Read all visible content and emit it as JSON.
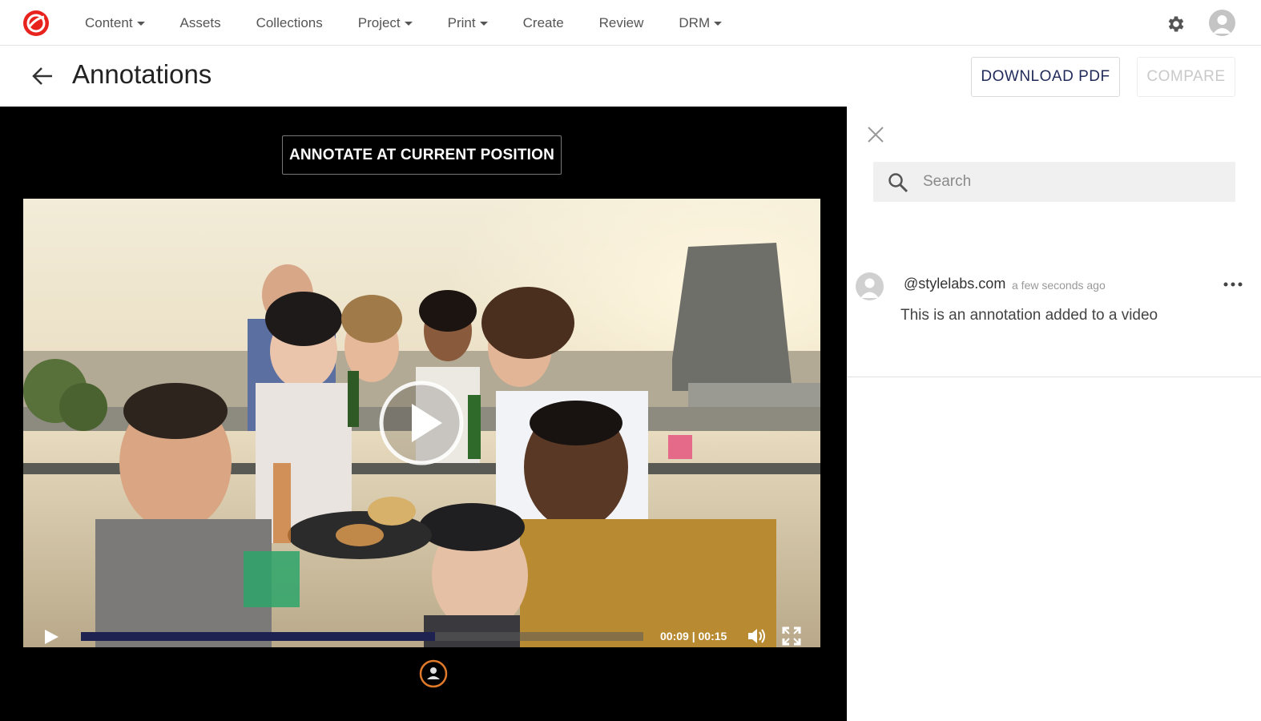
{
  "nav": {
    "items": [
      {
        "label": "Content",
        "dropdown": true
      },
      {
        "label": "Assets",
        "dropdown": false
      },
      {
        "label": "Collections",
        "dropdown": false
      },
      {
        "label": "Project",
        "dropdown": true
      },
      {
        "label": "Print",
        "dropdown": true
      },
      {
        "label": "Create",
        "dropdown": false
      },
      {
        "label": "Review",
        "dropdown": false
      },
      {
        "label": "DRM",
        "dropdown": true
      }
    ],
    "icons": {
      "logo": "brand-logo-icon",
      "settings": "gear-icon",
      "user": "user-avatar-icon"
    }
  },
  "header": {
    "title": "Annotations",
    "download_label": "DOWNLOAD PDF",
    "compare_label": "COMPARE"
  },
  "player": {
    "annotate_label": "ANNOTATE AT CURRENT POSITION",
    "time_display": "00:09 | 00:15",
    "progress": 0.63
  },
  "panel": {
    "search_placeholder": "Search",
    "comment": {
      "author": "@stylelabs.com",
      "time": "a few seconds ago",
      "text": "This is an annotation added to a video"
    }
  },
  "colors": {
    "brand": "#e8231e",
    "accent_navy": "#1f2a5a",
    "marker": "#e07a2a"
  }
}
